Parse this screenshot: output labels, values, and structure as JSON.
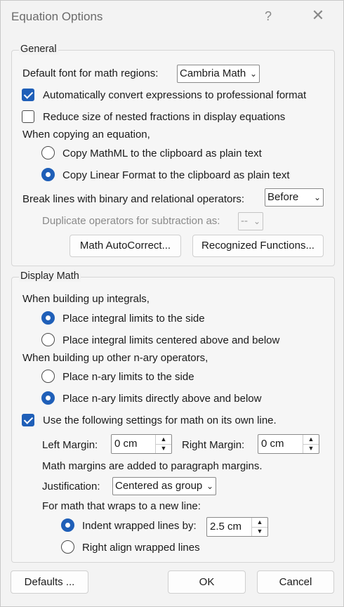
{
  "window": {
    "title": "Equation Options",
    "help_glyph": "?",
    "close_glyph": "✕"
  },
  "general": {
    "legend": "General",
    "default_font_label": "Default font for math regions:",
    "default_font_value": "Cambria Math",
    "auto_convert": {
      "label": "Automatically convert expressions to professional format",
      "checked": true
    },
    "reduce_size": {
      "label": "Reduce size of nested fractions in display equations",
      "checked": false
    },
    "copy_label": "When copying an equation,",
    "copy_mathml": {
      "label": "Copy MathML to the clipboard as plain text",
      "selected": false
    },
    "copy_linear": {
      "label": "Copy Linear Format to the clipboard as plain text",
      "selected": true
    },
    "break_lines_label": "Break lines with binary and relational operators:",
    "break_lines_value": "Before",
    "duplicate_label": "Duplicate operators for subtraction as:",
    "duplicate_value": "--",
    "math_autocorrect_button": "Math AutoCorrect...",
    "recognized_functions_button": "Recognized Functions..."
  },
  "display_math": {
    "legend": "Display Math",
    "integrals_label": "When building up integrals,",
    "integral_side": {
      "label": "Place integral limits to the side",
      "selected": true
    },
    "integral_centered": {
      "label": "Place integral limits centered above and below",
      "selected": false
    },
    "nary_label": "When building up other n-ary operators,",
    "nary_side": {
      "label": "Place n-ary limits to the side",
      "selected": false
    },
    "nary_above": {
      "label": "Place n-ary limits directly above and below",
      "selected": true
    },
    "use_settings": {
      "label": "Use the following settings for math on its own line.",
      "checked": true
    },
    "left_margin_label": "Left Margin:",
    "left_margin_value": "0 cm",
    "right_margin_label": "Right Margin:",
    "right_margin_value": "0 cm",
    "margins_note": "Math margins are added to paragraph margins.",
    "justification_label": "Justification:",
    "justification_value": "Centered as group",
    "wrap_label": "For math that wraps to a new line:",
    "indent_wrapped": {
      "label": "Indent wrapped lines by:",
      "selected": true
    },
    "indent_value": "2.5 cm",
    "right_align": {
      "label": "Right align wrapped lines",
      "selected": false
    }
  },
  "footer": {
    "defaults_button": "Defaults ...",
    "ok_button": "OK",
    "cancel_button": "Cancel"
  },
  "colors": {
    "accent": "#1f5fb8",
    "dialog_bg": "#f3f3f3"
  }
}
